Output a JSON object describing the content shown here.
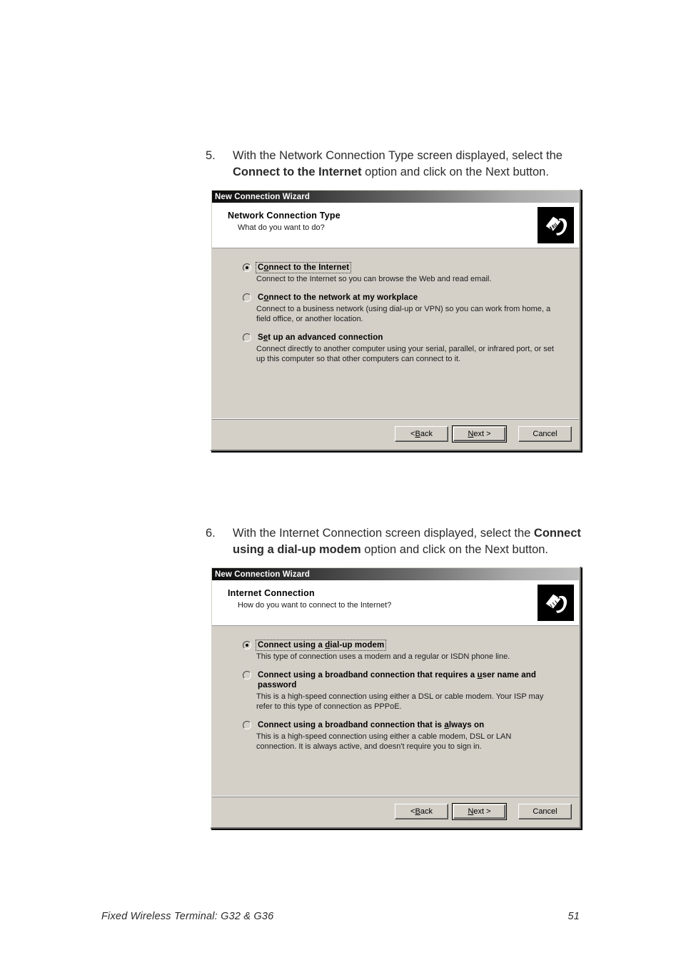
{
  "page": {
    "footer_text": "Fixed Wireless Terminal: G32 & G36",
    "page_number": "51"
  },
  "steps": [
    {
      "number": "5.",
      "text_before": "With the Network Connection Type screen displayed, select the ",
      "bold": "Connect to the Internet",
      "text_after": " option and click on the Next button."
    },
    {
      "number": "6.",
      "text_before": "With the Internet Connection screen displayed, select the ",
      "bold": "Connect using a dial-up modem",
      "text_after": " option and click on the Next button."
    }
  ],
  "wizards": [
    {
      "titlebar": "New Connection Wizard",
      "heading": "Network Connection Type",
      "subheading": "What do you want to do?",
      "icon": "network-connector-icon",
      "options": [
        {
          "label_pre": "C",
          "label_accel": "o",
          "label_post": "nnect to the Internet",
          "selected": true,
          "focused": true,
          "description": "Connect to the Internet so you can browse the Web and read email."
        },
        {
          "label_pre": "C",
          "label_accel": "o",
          "label_post": "nnect to the network at my workplace",
          "selected": false,
          "focused": false,
          "description": "Connect to a business network (using dial-up or VPN) so you can work from home, a field office, or another location."
        },
        {
          "label_pre": "S",
          "label_accel": "e",
          "label_post": "t up an advanced connection",
          "selected": false,
          "focused": false,
          "description": "Connect directly to another computer using your serial, parallel, or infrared port, or set up this computer so that other computers can connect to it."
        }
      ],
      "buttons": {
        "back_pre": "< ",
        "back_accel": "B",
        "back_post": "ack",
        "next_pre": "",
        "next_accel": "N",
        "next_post": "ext >",
        "cancel": "Cancel"
      }
    },
    {
      "titlebar": "New Connection Wizard",
      "heading": "Internet Connection",
      "subheading": "How do you want to connect to the Internet?",
      "icon": "network-connector-icon",
      "options": [
        {
          "label_pre": "Connect using a ",
          "label_accel": "d",
          "label_post": "ial-up modem",
          "selected": true,
          "focused": true,
          "description": "This type of connection uses a modem and a regular or ISDN phone line."
        },
        {
          "label_pre": "Connect using a broadband connection that requires a ",
          "label_accel": "u",
          "label_post": "ser name and password",
          "selected": false,
          "focused": false,
          "description": "This is a high-speed connection using either a DSL or cable modem. Your ISP may refer to this type of connection as PPPoE."
        },
        {
          "label_pre": "Connect using a broadband connection that is ",
          "label_accel": "a",
          "label_post": "lways on",
          "selected": false,
          "focused": false,
          "description": "This is a high-speed connection using either a cable modem, DSL or LAN connection. It is always active, and doesn't require you to sign in."
        }
      ],
      "buttons": {
        "back_pre": "< ",
        "back_accel": "B",
        "back_post": "ack",
        "next_pre": "",
        "next_accel": "N",
        "next_post": "ext >",
        "cancel": "Cancel"
      }
    }
  ]
}
